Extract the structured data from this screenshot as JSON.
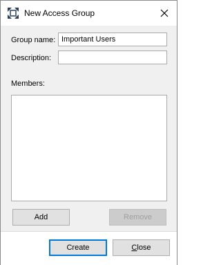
{
  "window": {
    "title": "New Access Group",
    "close_icon": "close-icon"
  },
  "form": {
    "group_name_label": "Group name:",
    "group_name_value": "Important Users",
    "description_label": "Description:",
    "description_value": "",
    "members_label": "Members:",
    "members": []
  },
  "buttons": {
    "add": "Add",
    "remove": "Remove",
    "create": "Create",
    "close": "Close"
  },
  "colors": {
    "accent": "#0078d7",
    "dialog_bg": "#f0f0f0"
  }
}
